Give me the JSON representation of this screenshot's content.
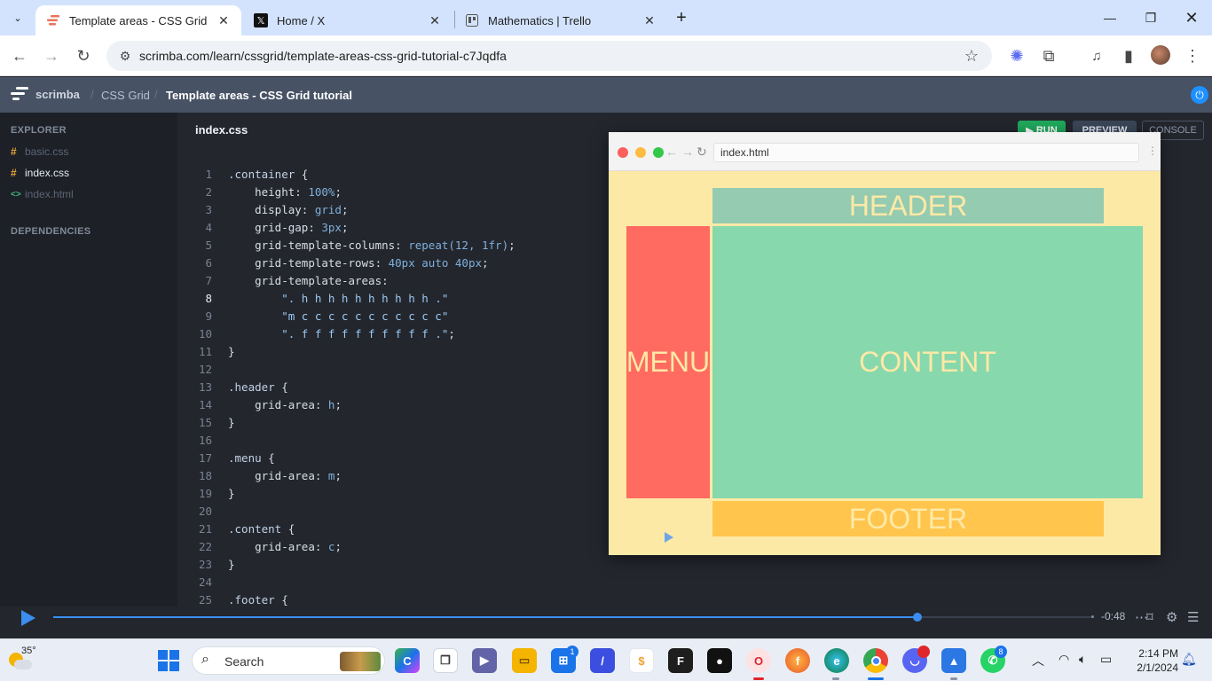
{
  "browser": {
    "tabs": [
      {
        "title": "Template areas - CSS Grid tutor",
        "favicon": "scrimba-favicon",
        "active": true
      },
      {
        "title": "Home / X",
        "favicon": "x-favicon",
        "active": false
      },
      {
        "title": "Mathematics | Trello",
        "favicon": "trello-favicon",
        "active": false
      }
    ],
    "url": "scrimba.com/learn/cssgrid/template-areas-css-grid-tutorial-c7Jqdfa"
  },
  "scrimba": {
    "logo": "scrimba",
    "breadcrumb": [
      "CSS Grid",
      "Template areas - CSS Grid tutorial"
    ]
  },
  "sidebar": {
    "explorer_label": "EXPLORER",
    "files": [
      {
        "name": "basic.css",
        "type": "css",
        "selected": false
      },
      {
        "name": "index.css",
        "type": "css",
        "selected": true
      },
      {
        "name": "index.html",
        "type": "html",
        "selected": false
      }
    ],
    "dependencies_label": "DEPENDENCIES"
  },
  "editor": {
    "filename": "index.css",
    "current_line": 8,
    "lines": [
      {
        "n": "1",
        "t": ".container {"
      },
      {
        "n": "2",
        "t": "    height: 100%;"
      },
      {
        "n": "3",
        "t": "    display: grid;"
      },
      {
        "n": "4",
        "t": "    grid-gap: 3px;"
      },
      {
        "n": "5",
        "t": "    grid-template-columns: repeat(12, 1fr);"
      },
      {
        "n": "6",
        "t": "    grid-template-rows: 40px auto 40px;"
      },
      {
        "n": "7",
        "t": "    grid-template-areas:"
      },
      {
        "n": "8",
        "t": "        \". h h h h h h h h h h .\""
      },
      {
        "n": "9",
        "t": "        \"m c c c c c c c c c c c\""
      },
      {
        "n": "10",
        "t": "        \". f f f f f f f f f f .\";"
      },
      {
        "n": "11",
        "t": "}"
      },
      {
        "n": "12",
        "t": ""
      },
      {
        "n": "13",
        "t": ".header {"
      },
      {
        "n": "14",
        "t": "    grid-area: h;"
      },
      {
        "n": "15",
        "t": "}"
      },
      {
        "n": "16",
        "t": ""
      },
      {
        "n": "17",
        "t": ".menu {"
      },
      {
        "n": "18",
        "t": "    grid-area: m;"
      },
      {
        "n": "19",
        "t": "}"
      },
      {
        "n": "20",
        "t": ""
      },
      {
        "n": "21",
        "t": ".content {"
      },
      {
        "n": "22",
        "t": "    grid-area: c;"
      },
      {
        "n": "23",
        "t": "}"
      },
      {
        "n": "24",
        "t": ""
      },
      {
        "n": "25",
        "t": ".footer {"
      }
    ]
  },
  "buttons": {
    "run": "RUN",
    "preview": "PREVIEW",
    "console": "CONSOLE"
  },
  "preview": {
    "url": "index.html",
    "areas": {
      "header": "HEADER",
      "menu": "MENU",
      "content": "CONTENT",
      "footer": "FOOTER"
    },
    "colors": {
      "bg": "#fde9a6",
      "header": "#95cbb0",
      "menu": "#ff6b61",
      "content": "#88d8ad",
      "footer": "#ffc54d"
    }
  },
  "player": {
    "time": "-0:48",
    "progress": 0.83
  },
  "taskbar": {
    "temp": "35°",
    "search": "Search",
    "store_badge": "1",
    "whatsapp_badge": "8",
    "time": "2:14 PM",
    "date": "2/1/2024"
  }
}
